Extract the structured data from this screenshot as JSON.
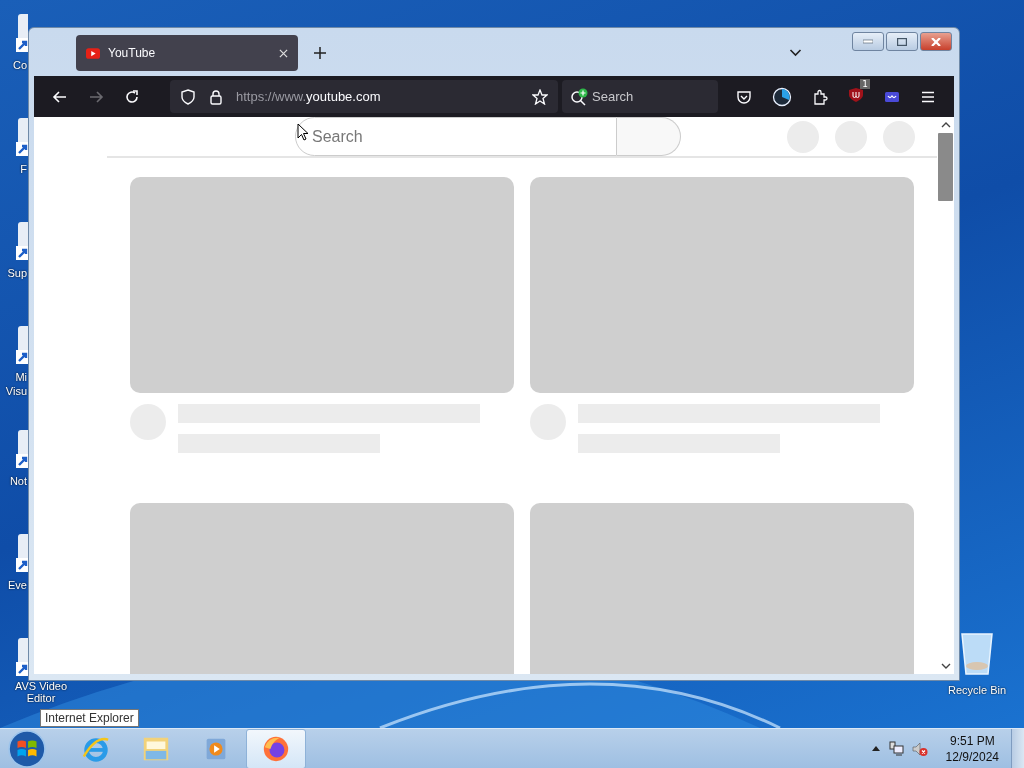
{
  "desktop_icons": [
    {
      "label": "Co"
    },
    {
      "label": "F"
    },
    {
      "label": "Sup"
    },
    {
      "label": "Mi Visu"
    },
    {
      "label": "Not"
    },
    {
      "label": "Eve"
    },
    {
      "label": "AVS Video Editor"
    }
  ],
  "recycle_bin": {
    "label": "Recycle Bin"
  },
  "browser": {
    "tabs": [
      {
        "title": "YouTube",
        "selected": true
      }
    ],
    "nav": {
      "back_disabled": false,
      "forward_disabled": true
    },
    "url": {
      "prefix": "https://www.",
      "domain": "youtube.com"
    },
    "search": {
      "placeholder": "Search"
    },
    "extension_badge": "1",
    "page": {
      "search": {
        "placeholder": "Search"
      }
    }
  },
  "taskbar": {
    "items": [
      {
        "kind": "ie",
        "selected": false
      },
      {
        "kind": "explorer",
        "selected": false
      },
      {
        "kind": "media",
        "selected": false
      },
      {
        "kind": "firefox",
        "selected": true
      }
    ],
    "tooltip": "Internet Explorer",
    "clock": {
      "time": "9:51 PM",
      "date": "12/9/2024"
    }
  }
}
